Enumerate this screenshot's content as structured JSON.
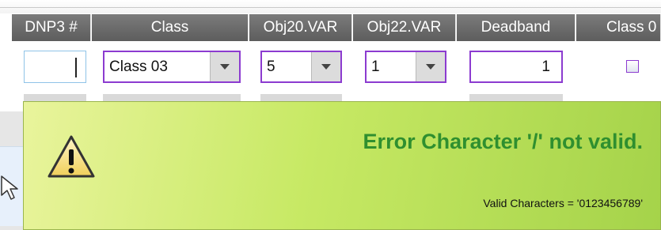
{
  "columns": [
    {
      "key": "dnp3",
      "label": "DNP3 #"
    },
    {
      "key": "class",
      "label": "Class"
    },
    {
      "key": "obj20",
      "label": "Obj20.VAR"
    },
    {
      "key": "obj22",
      "label": "Obj22.VAR"
    },
    {
      "key": "deadband",
      "label": "Deadband"
    },
    {
      "key": "class0",
      "label": "Class 0"
    }
  ],
  "row": {
    "dnp3_value": "",
    "class_value": "Class 03",
    "obj20_value": "5",
    "obj22_value": "1",
    "deadband_value": "1",
    "class0_checked": false
  },
  "tooltip": {
    "title": "Error Character '/' not valid.",
    "detail": "Valid Characters = '0123456789'",
    "icon": "warning-icon"
  },
  "colors": {
    "header_bg": "#6e6e6e",
    "focus_border": "#8c3bd0",
    "error_text": "#2f8f2f",
    "tooltip_bg": "#b9df5a"
  }
}
